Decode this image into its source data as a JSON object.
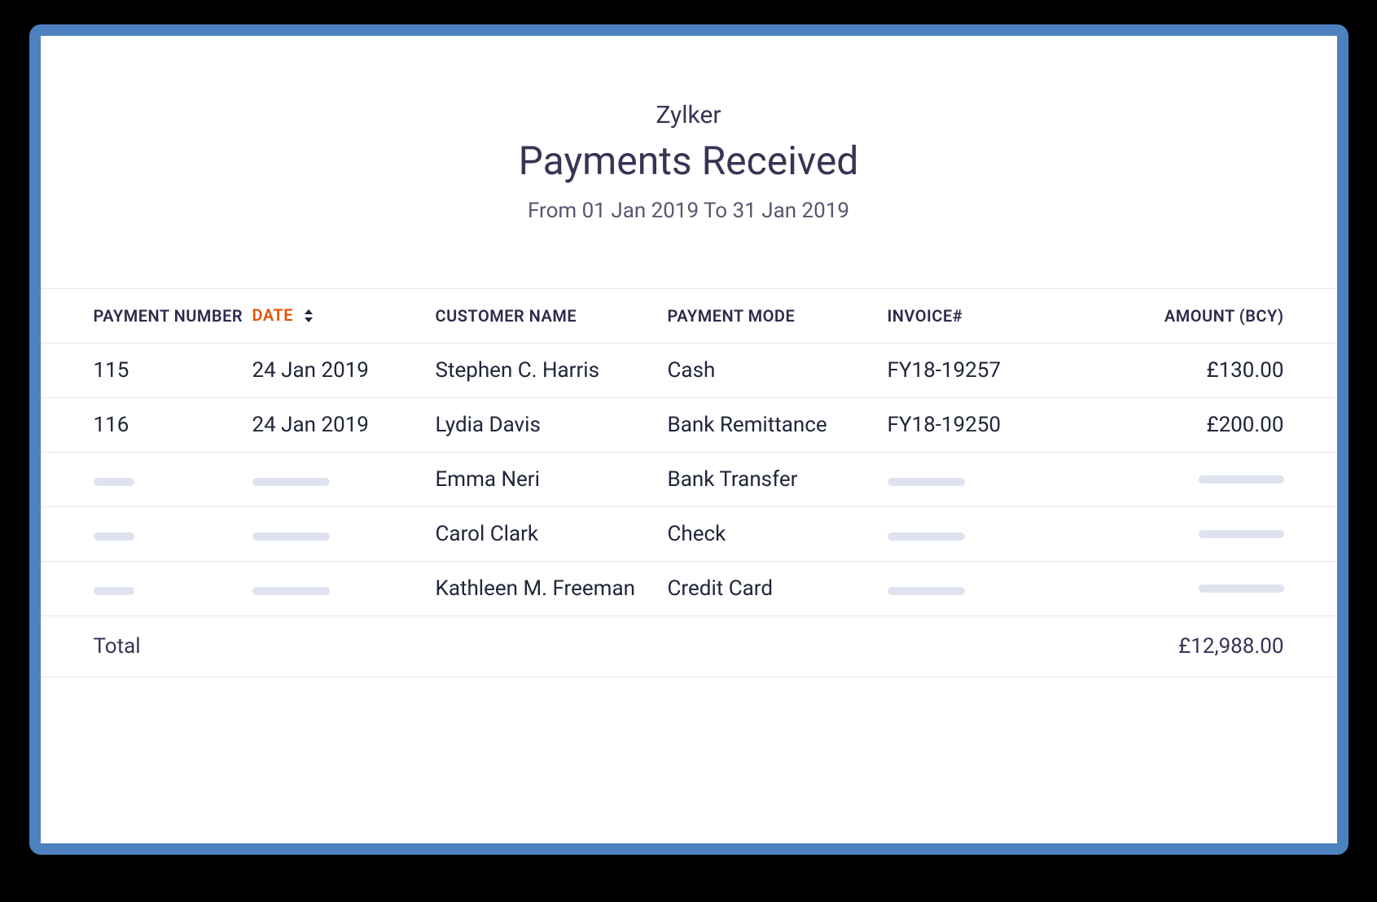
{
  "header": {
    "company": "Zylker",
    "title": "Payments Received",
    "date_range": "From 01 Jan 2019 To 31 Jan 2019"
  },
  "columns": {
    "payment_number": "PAYMENT NUMBER",
    "date": "DATE",
    "customer_name": "CUSTOMER NAME",
    "payment_mode": "PAYMENT MODE",
    "invoice": "INVOICE#",
    "amount": "AMOUNT (BCY)"
  },
  "rows": [
    {
      "payment_number": "115",
      "date": "24 Jan 2019",
      "customer": "Stephen C. Harris",
      "mode": "Cash",
      "invoice": "FY18-19257",
      "amount": "£130.00"
    },
    {
      "payment_number": "116",
      "date": "24 Jan 2019",
      "customer": "Lydia Davis",
      "mode": "Bank Remittance",
      "invoice": "FY18-19250",
      "amount": "£200.00"
    },
    {
      "payment_number": "",
      "date": "",
      "customer": "Emma Neri",
      "mode": "Bank Transfer",
      "invoice": "",
      "amount": ""
    },
    {
      "payment_number": "",
      "date": "",
      "customer": "Carol Clark",
      "mode": "Check",
      "invoice": "",
      "amount": ""
    },
    {
      "payment_number": "",
      "date": "",
      "customer": "Kathleen M. Freeman",
      "mode": "Credit Card",
      "invoice": "",
      "amount": ""
    }
  ],
  "total": {
    "label": "Total",
    "amount": "£12,988.00"
  }
}
